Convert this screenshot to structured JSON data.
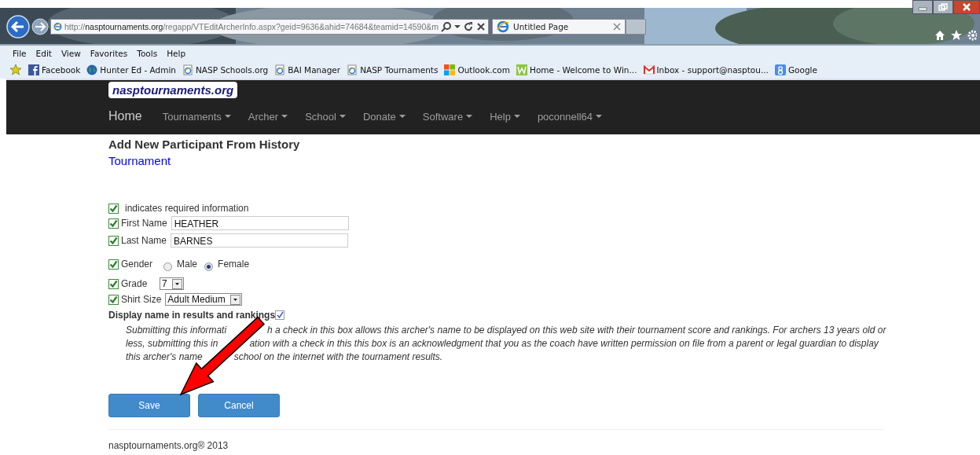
{
  "browser": {
    "address": "http://**nasptournaments.org**/regapp/VTEditArcherInfo.aspx?geid=9636&ahid=74684&teamid=14590&m",
    "tabs": [
      {
        "label": "Untitled Page",
        "selected": true
      }
    ],
    "menu": [
      "File",
      "Edit",
      "View",
      "Favorites",
      "Tools",
      "Help"
    ],
    "favorites": [
      {
        "label": "Facebook",
        "kind": "facebook"
      },
      {
        "label": "Hunter Ed - Admin",
        "kind": "globe"
      },
      {
        "label": "NASP Schools.org",
        "kind": "page"
      },
      {
        "label": "BAI Manager",
        "kind": "page"
      },
      {
        "label": "NASP Tournaments",
        "kind": "page"
      },
      {
        "label": "Outlook.com",
        "kind": "windows"
      },
      {
        "label": "Home - Welcome to Win...",
        "kind": "green"
      },
      {
        "label": "Inbox - support@nasptou...",
        "kind": "mail"
      },
      {
        "label": "Google",
        "kind": "google"
      }
    ]
  },
  "navbar": {
    "brand": "nasptournaments.org",
    "items": [
      {
        "label": "Home",
        "kind": "home"
      },
      {
        "label": "Tournaments",
        "kind": "dropdown"
      },
      {
        "label": "Archer",
        "kind": "dropdown"
      },
      {
        "label": "School",
        "kind": "dropdown"
      },
      {
        "label": "Donate",
        "kind": "dropdown"
      },
      {
        "label": "Software",
        "kind": "dropdown"
      },
      {
        "label": "Help",
        "kind": "dropdown"
      },
      {
        "label": "poconnell64",
        "kind": "dropdown"
      }
    ]
  },
  "form": {
    "title": "Add New Participant From History",
    "subtitle": "Tournament",
    "legend": "indicates required information",
    "fields": [
      {
        "kind": "text",
        "label": "First Name",
        "value": "HEATHER"
      },
      {
        "kind": "text",
        "label": "Last Name",
        "value": "BARNES"
      },
      {
        "kind": "radio",
        "label": "Gender",
        "options": [
          {
            "label": "Male",
            "selected": false
          },
          {
            "label": "Female",
            "selected": true
          }
        ]
      },
      {
        "kind": "select",
        "label": "Grade",
        "value": "7"
      },
      {
        "kind": "select",
        "label": "Shirt Size",
        "value": "Adult Medium"
      }
    ],
    "consent": {
      "label": "Display name in results and rankings",
      "checked": true
    },
    "disclaimer": [
      [
        "Submitting this informati",
        "h a check in this box allows this archer's name to be displayed on this web site with their tournament score and rankings. For archers 13 years old or"
      ],
      [
        "less, submitting this in",
        "ation with a check in this this box is an acknowledgment that you as the coach have written permission on file from a parent or legal guardian to display"
      ],
      [
        "this archer's name",
        "school on the internet with the tournament results."
      ]
    ],
    "buttons": [
      "Save",
      "Cancel"
    ]
  },
  "footer": "nasptournaments.org® 2013"
}
